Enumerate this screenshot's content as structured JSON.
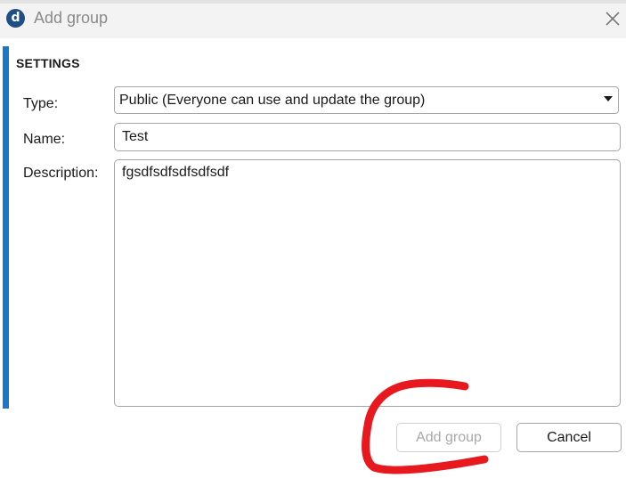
{
  "window": {
    "title": "Add group",
    "app_icon_letter": "d",
    "close_icon": "close-icon"
  },
  "section": {
    "heading": "SETTINGS"
  },
  "form": {
    "type_label": "Type:",
    "type_value": "Public (Everyone can use and update the group)",
    "name_label": "Name:",
    "name_value": "Test",
    "description_label": "Description:",
    "description_value": "fgsdfsdfsdfsdfsdf"
  },
  "buttons": {
    "add_label": "Add group",
    "add_enabled": false,
    "cancel_label": "Cancel"
  },
  "colors": {
    "accent": "#1976c9",
    "annotation": "#e8191e",
    "app_icon": "#1f4f86"
  }
}
